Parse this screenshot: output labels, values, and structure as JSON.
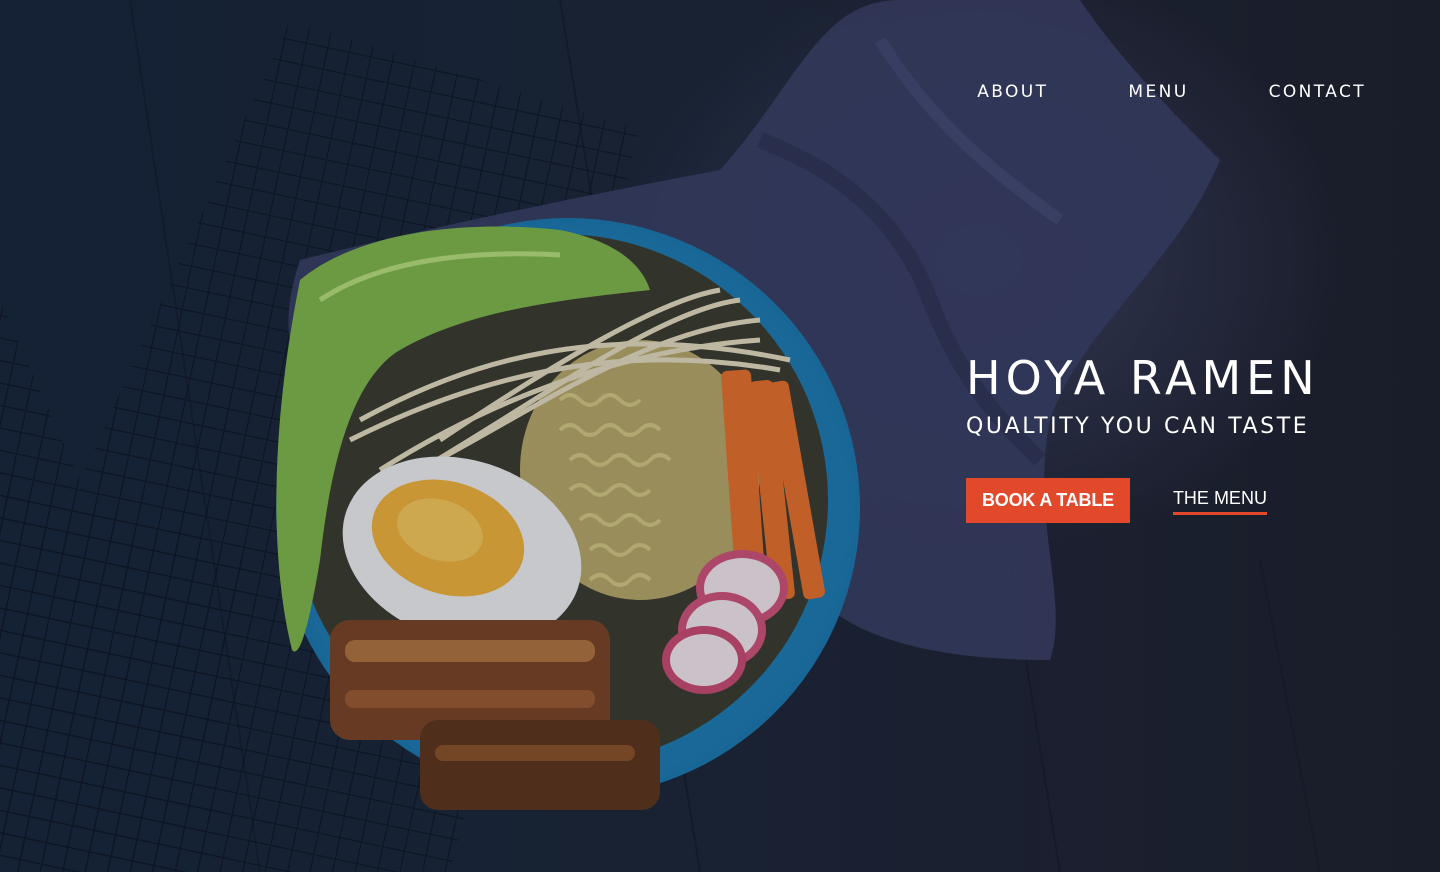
{
  "nav": {
    "items": [
      {
        "label": "ABOUT"
      },
      {
        "label": "MENU"
      },
      {
        "label": "CONTACT"
      }
    ]
  },
  "hero": {
    "title": "HOYA RAMEN",
    "subtitle": "QUALTITY YOU CAN TASTE",
    "primary_button": "BOOK A TABLE",
    "secondary_link": "THE MENU"
  },
  "colors": {
    "accent": "#e2492b",
    "background": "#1b2130",
    "text": "#ffffff"
  },
  "background_image": "ramen-bowl-photo"
}
